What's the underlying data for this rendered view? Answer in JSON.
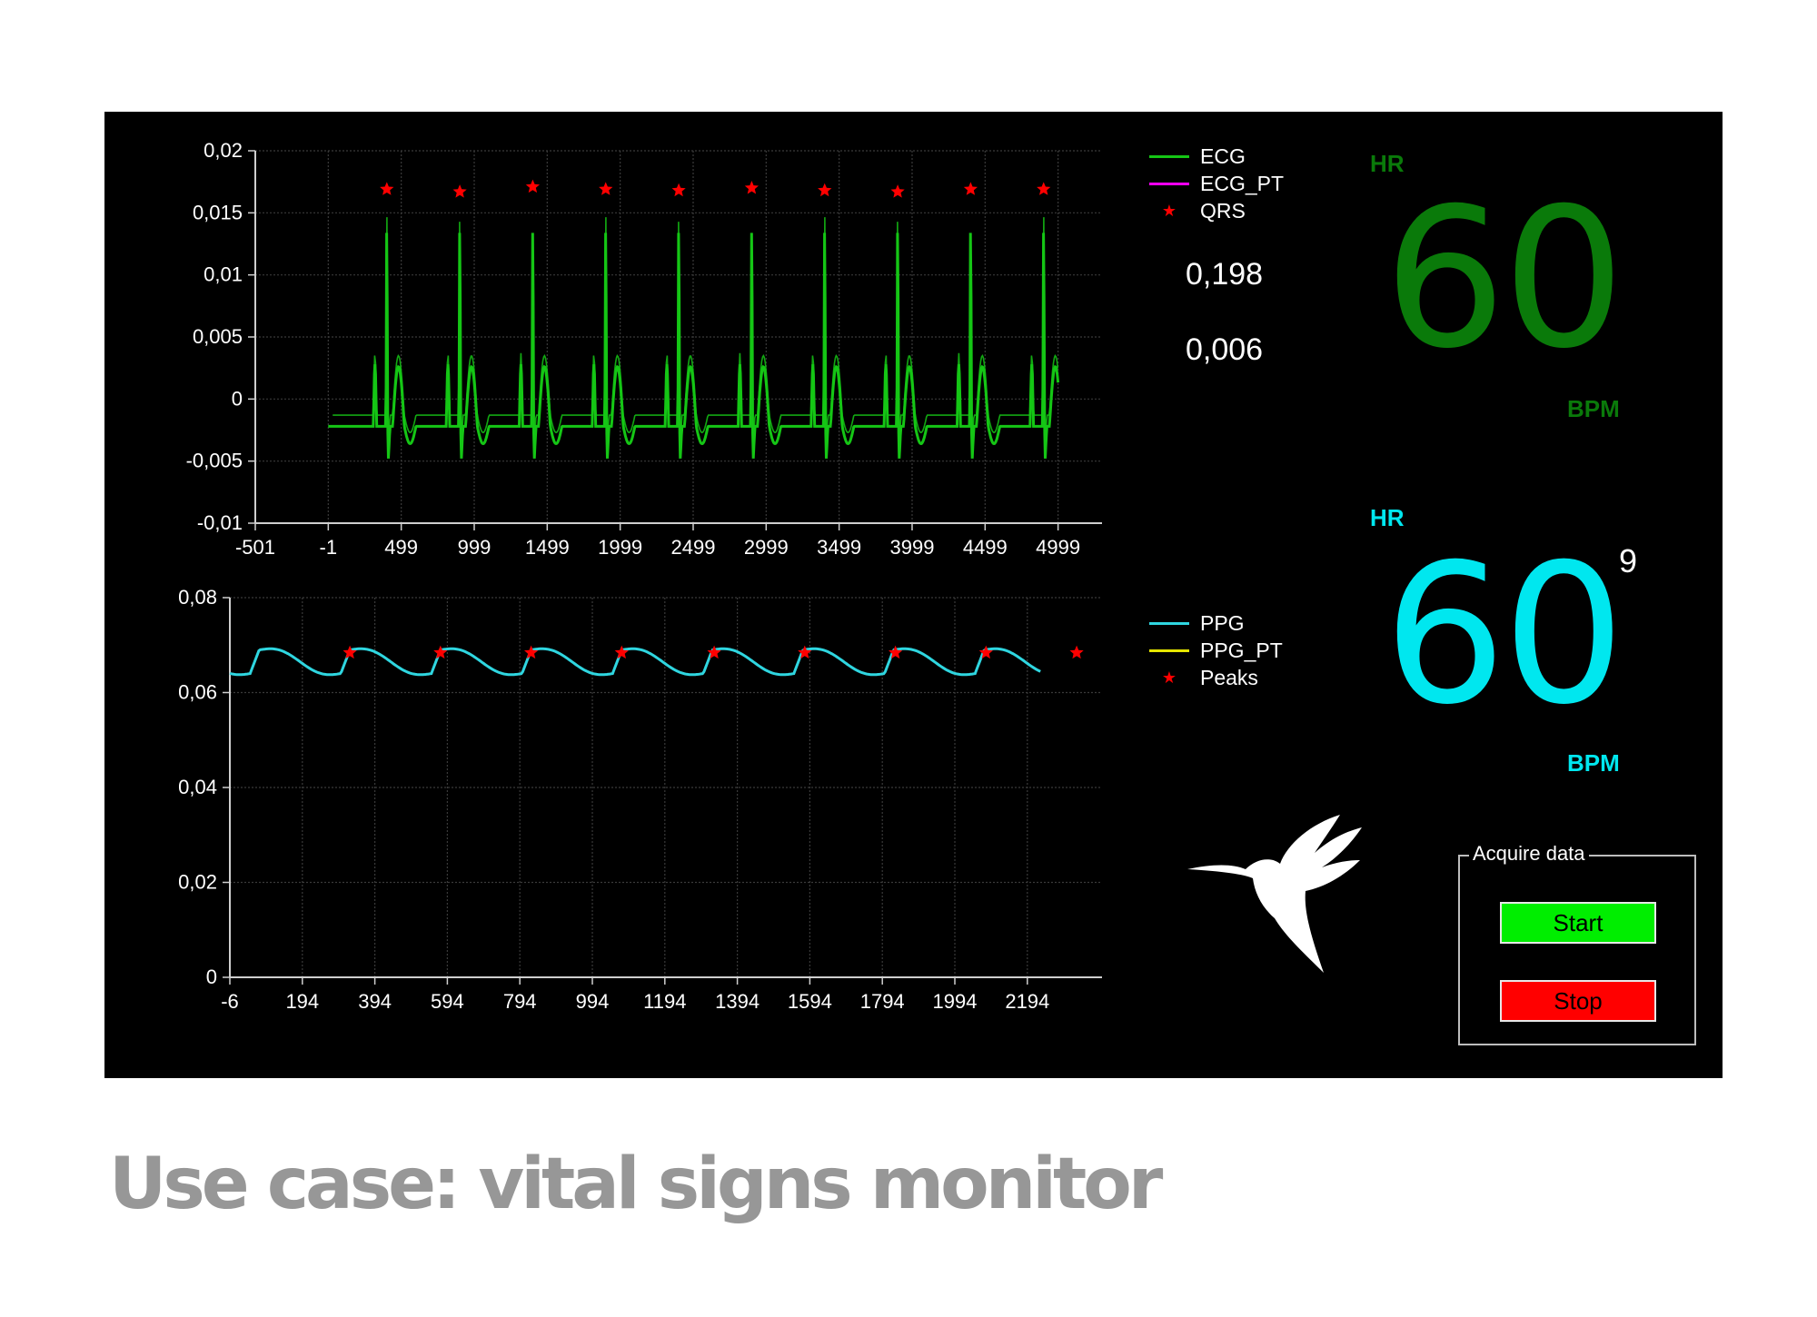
{
  "caption": "Use case: vital signs monitor",
  "ecg": {
    "legend": {
      "signal": "ECG",
      "filtered": "ECG_PT",
      "markers": "QRS"
    },
    "readouts": [
      "0,198",
      "0,006"
    ],
    "hr": {
      "label": "HR",
      "value": "60",
      "unit": "BPM",
      "color": "#0a7a0a"
    }
  },
  "ppg": {
    "legend": {
      "signal": "PPG",
      "filtered": "PPG_PT",
      "markers": "Peaks"
    },
    "aux_value": "9",
    "hr": {
      "label": "HR",
      "value": "60",
      "unit": "BPM",
      "color": "#00e7ef"
    }
  },
  "acquire": {
    "title": "Acquire data",
    "start_label": "Start",
    "stop_label": "Stop",
    "start_color": "#00ee00",
    "stop_color": "#ff0000"
  },
  "icons": {
    "logo": "hummingbird-logo-icon"
  },
  "chart_data": [
    {
      "type": "line",
      "title": "",
      "xlabel": "",
      "ylabel": "",
      "xlim": [
        -501,
        5300
      ],
      "ylim": [
        -0.01,
        0.02
      ],
      "xticks": [
        -501,
        -1,
        499,
        999,
        1499,
        1999,
        2499,
        2999,
        3499,
        3999,
        4499,
        4999
      ],
      "xtick_labels": [
        "-501",
        "-1",
        "499",
        "999",
        "1499",
        "1999",
        "2499",
        "2999",
        "3499",
        "3999",
        "4499",
        "4999"
      ],
      "yticks": [
        -0.01,
        -0.005,
        0,
        0.005,
        0.01,
        0.015,
        0.02
      ],
      "ytick_labels": [
        "-0,01",
        "-0,005",
        "0",
        "0,005",
        "0,01",
        "0,015",
        "0,02"
      ],
      "grid": true,
      "legend_position": "right",
      "series": [
        {
          "name": "ECG",
          "color": "#15c615",
          "x_range": [
            -1,
            4999
          ],
          "baseline": -0.0022,
          "r_peaks_x": [
            400,
            900,
            1400,
            1900,
            2400,
            2900,
            3400,
            3900,
            4400,
            4900
          ],
          "r_peak_y": 0.0165,
          "s_trough_y": -0.0055
        },
        {
          "name": "ECG_PT",
          "color": "#ff00ff",
          "values": []
        },
        {
          "name": "QRS",
          "color": "#ff0000",
          "marker": "star",
          "x": [
            400,
            900,
            1400,
            1900,
            2400,
            2900,
            3400,
            3900,
            4400,
            4900
          ],
          "y": [
            0.0169,
            0.0167,
            0.0171,
            0.0169,
            0.0168,
            0.017,
            0.0168,
            0.0167,
            0.0169,
            0.0169
          ]
        }
      ]
    },
    {
      "type": "line",
      "title": "",
      "xlabel": "",
      "ylabel": "",
      "xlim": [
        -6,
        2400
      ],
      "ylim": [
        0,
        0.08
      ],
      "xticks": [
        -6,
        194,
        394,
        594,
        794,
        994,
        1194,
        1394,
        1594,
        1794,
        1994,
        2194
      ],
      "xtick_labels": [
        "-6",
        "194",
        "394",
        "594",
        "794",
        "994",
        "1194",
        "1394",
        "1594",
        "1794",
        "1994",
        "2194"
      ],
      "yticks": [
        0,
        0.02,
        0.04,
        0.06,
        0.08
      ],
      "ytick_labels": [
        "0",
        "0,02",
        "0,04",
        "0,06",
        "0,08"
      ],
      "grid": true,
      "legend_position": "right",
      "series": [
        {
          "name": "PPG",
          "color": "#2fd6e0",
          "x_range": [
            -6,
            2230
          ],
          "trough_y": 0.064,
          "peak_y": 0.069
        },
        {
          "name": "PPG_PT",
          "color": "#e6e600",
          "values": []
        },
        {
          "name": "Peaks",
          "color": "#ff0000",
          "marker": "star",
          "x": [
            325,
            575,
            825,
            1075,
            1330,
            1580,
            1830,
            2080,
            2330
          ],
          "y": [
            0.0684,
            0.0684,
            0.0684,
            0.0684,
            0.0684,
            0.0684,
            0.0684,
            0.0684,
            0.0684
          ]
        }
      ]
    }
  ]
}
